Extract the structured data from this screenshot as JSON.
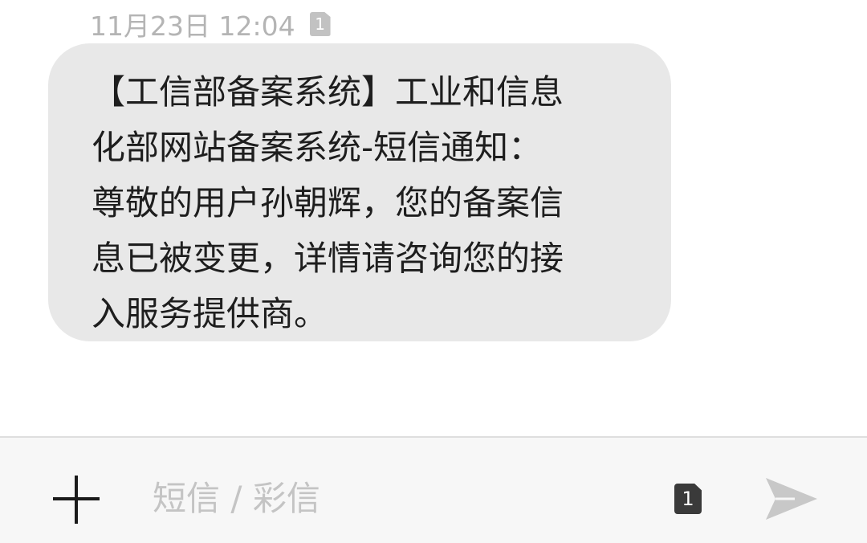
{
  "thread": {
    "timestamp": "11月23日 12:04",
    "sim_label": "1",
    "message": "【工信部备案系统】工业和信息\n化部网站备案系统-短信通知：\n尊敬的用户孙朝辉，您的备案信\n息已被变更，详情请咨询您的接\n入服务提供商。"
  },
  "composer": {
    "add_icon": "plus-icon",
    "input_value": "",
    "input_placeholder": "短信 / 彩信",
    "sim_selector_label": "1",
    "send_icon": "send-icon"
  },
  "colors": {
    "bubble_bg": "#e8e8e8",
    "timestamp": "#b4b4b4",
    "placeholder": "#c4c4c4",
    "send_icon": "#c8c8c8"
  }
}
